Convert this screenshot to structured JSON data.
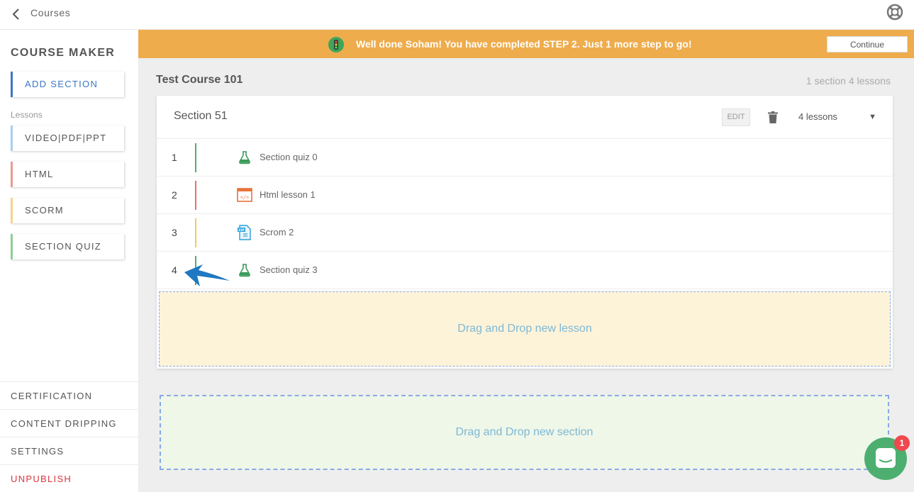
{
  "topbar": {
    "title": "Courses"
  },
  "sidebar": {
    "heading": "COURSE MAKER",
    "add_section": "ADD SECTION",
    "lessons_label": "Lessons",
    "lesson_types": [
      "VIDEO|PDF|PPT",
      "HTML",
      "SCORM",
      "SECTION QUIZ"
    ],
    "bottom_items": [
      "CERTIFICATION",
      "CONTENT DRIPPING",
      "SETTINGS",
      "UNPUBLISH"
    ]
  },
  "banner": {
    "text": "Well done Soham! You have completed STEP 2. Just 1 more step to go!",
    "continue_label": "Continue"
  },
  "course": {
    "title": "Test Course 101",
    "summary": "1 section 4 lessons"
  },
  "section": {
    "title": "Section 51",
    "edit_label": "EDIT",
    "lessons_dropdown": "4 lessons",
    "lessons": [
      {
        "num": "1",
        "label": "Section quiz 0",
        "type": "quiz"
      },
      {
        "num": "2",
        "label": "Html lesson 1",
        "type": "html"
      },
      {
        "num": "3",
        "label": "Scrom 2",
        "type": "scorm"
      },
      {
        "num": "4",
        "label": "Section quiz 3",
        "type": "quiz"
      }
    ],
    "drop_lesson": "Drag and Drop new lesson"
  },
  "drop_section": "Drag and Drop new section",
  "chat": {
    "badge": "1"
  },
  "colors": {
    "banner": "#eeac4c",
    "accent_blue": "#3b78c3",
    "quiz": "#4caf6f",
    "html": "#e57368",
    "scorm": "#f6c95a",
    "danger": "#d9363e"
  }
}
